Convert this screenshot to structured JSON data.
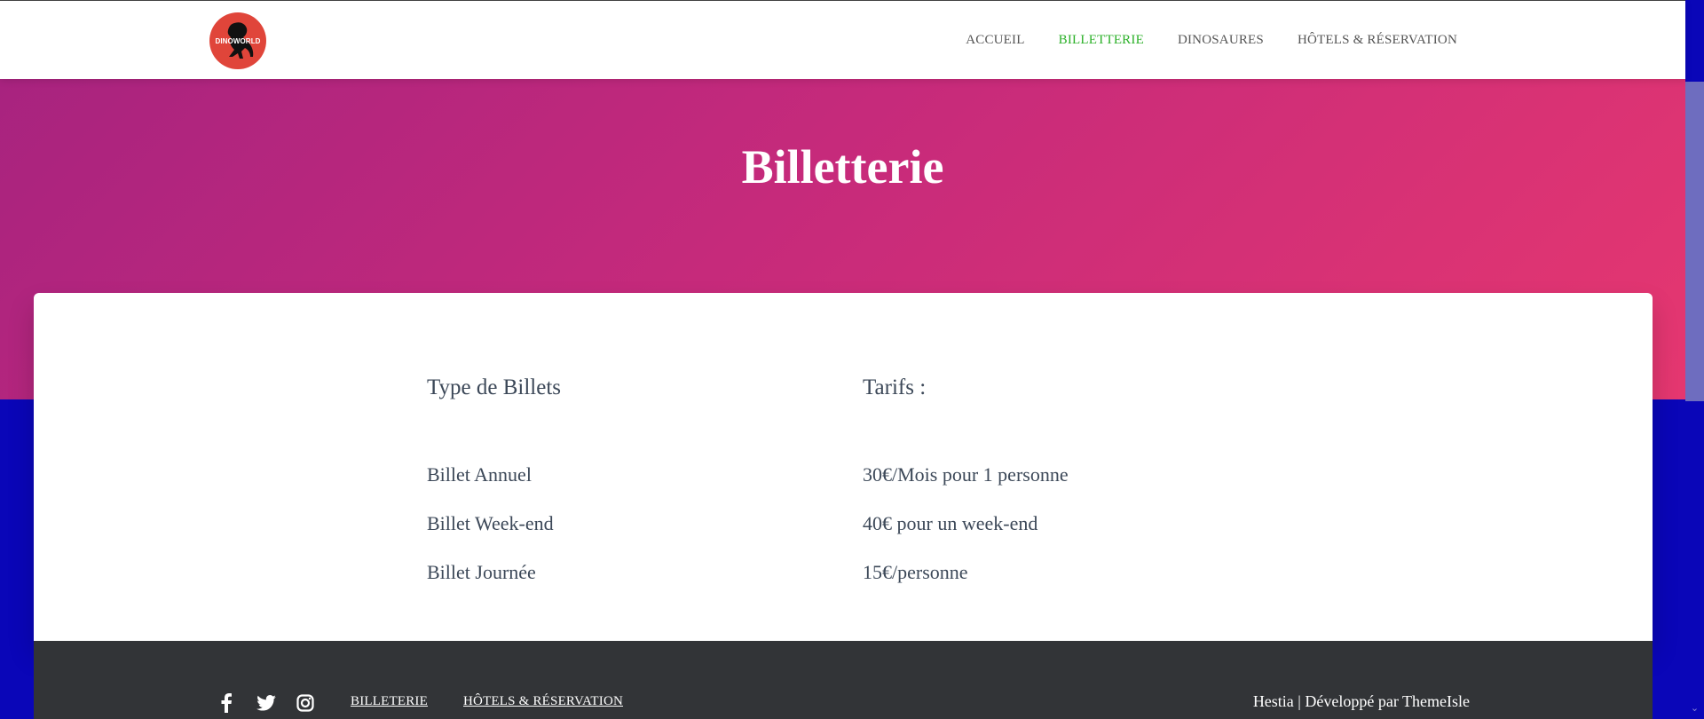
{
  "header": {
    "logo_text": "DINOWORLD",
    "nav": [
      {
        "label": "ACCUEIL",
        "active": false
      },
      {
        "label": "BILLETTERIE",
        "active": true
      },
      {
        "label": "DINOSAURES",
        "active": false
      },
      {
        "label": "HÔTELS & RÉSERVATION",
        "active": false
      }
    ],
    "active_color": "#2ab027"
  },
  "hero": {
    "title": "Billetterie",
    "gradient_start": "#a8237f",
    "gradient_end": "#e53770"
  },
  "table": {
    "headers": [
      "Type de Billets",
      "Tarifs :"
    ],
    "rows": [
      [
        "Billet Annuel",
        "30€/Mois pour 1 personne"
      ],
      [
        "Billet Week-end",
        "40€ pour un week-end"
      ],
      [
        "Billet Journée",
        "15€/personne"
      ]
    ]
  },
  "footer": {
    "social_icons": [
      "facebook-icon",
      "twitter-icon",
      "instagram-icon"
    ],
    "links": [
      "BILLETERIE",
      "HÔTELS & RÉSERVATION"
    ],
    "credit_brand": "Hestia",
    "credit_sep": " | ",
    "credit_text": "Développé par ThemeIsle"
  },
  "colors": {
    "page_background": "#0a06b8",
    "footer_background": "#323437",
    "text_dark": "#3c4858"
  }
}
